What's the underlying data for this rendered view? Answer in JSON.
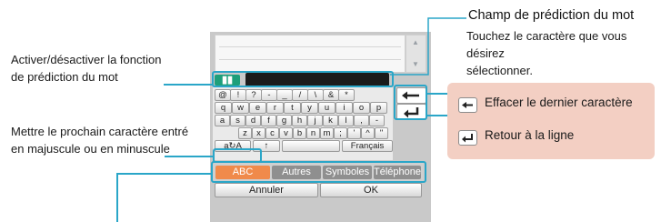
{
  "annotations": {
    "prediction_field_title": "Champ de prédiction du mot",
    "prediction_field_desc": [
      "Touchez le caractère que vous désirez",
      "sélectionner."
    ],
    "toggle_prediction": [
      "Activer/désactiver la fonction",
      "de prédiction du mot"
    ],
    "shift_case": [
      "Mettre le prochain caractère entré",
      "en majuscule ou en minuscule"
    ]
  },
  "legend": {
    "backspace": "Effacer le dernier caractère",
    "newline": "Retour à la ligne"
  },
  "keyboard": {
    "row1": [
      "@",
      "!",
      "?",
      "-",
      "_",
      "/",
      "\\",
      "&",
      "*"
    ],
    "row2": [
      "q",
      "w",
      "e",
      "r",
      "t",
      "y",
      "u",
      "i",
      "o",
      "p"
    ],
    "row3": [
      "a",
      "s",
      "d",
      "f",
      "g",
      "h",
      "j",
      "k",
      "l",
      ",",
      "-"
    ],
    "row4": [
      "z",
      "x",
      "c",
      "v",
      "b",
      "n",
      "m",
      ";",
      "'",
      "^",
      "\""
    ],
    "shift_label": "a↻A",
    "up_arrow": "↑",
    "language_label": "Français",
    "backspace_glyph": "←",
    "enter_glyph": "↵"
  },
  "mode_tabs": [
    "ABC",
    "Autres",
    "Symboles",
    "Téléphone"
  ],
  "bottom_buttons": {
    "cancel": "Annuler",
    "ok": "OK"
  },
  "colors": {
    "accent": "#2aa6c8",
    "active_tab": "#f08a4b",
    "legend_bg": "#f3cfc3",
    "prediction_icon": "#1e9f7a"
  }
}
